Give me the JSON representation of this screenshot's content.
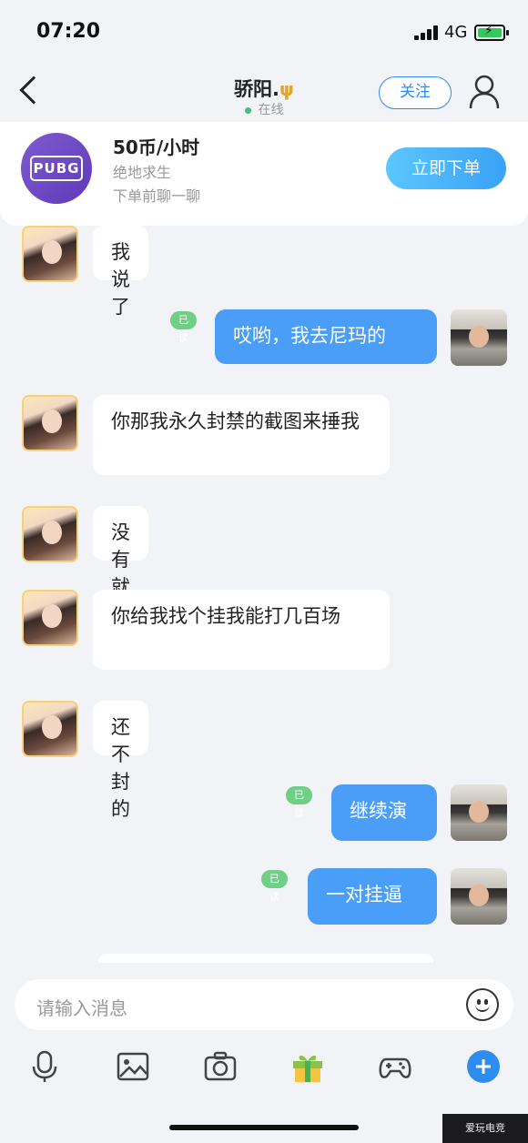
{
  "status": {
    "time": "07:20",
    "network": "4G"
  },
  "header": {
    "title": "骄阳.",
    "title_icon": "trident-icon",
    "online": "在线",
    "follow": "关注"
  },
  "order": {
    "logo_text": "PUBG",
    "price": "50币/小时",
    "game": "绝地求生",
    "hint": "下单前聊一聊",
    "button": "立即下单"
  },
  "messages": [
    {
      "side": "in",
      "text": "我说了"
    },
    {
      "side": "out",
      "text": "哎哟，我去尼玛的",
      "read": "已读"
    },
    {
      "side": "in",
      "text": "你那我永久封禁的截图来捶我"
    },
    {
      "side": "in",
      "text": "没有就别说"
    },
    {
      "side": "in",
      "text": "你给我找个挂我能打几百场"
    },
    {
      "side": "in",
      "text": "还不封的"
    },
    {
      "side": "out",
      "text": "继续演",
      "read": "已读"
    },
    {
      "side": "out",
      "text": "一对挂逼",
      "read": "已读"
    }
  ],
  "composer": {
    "placeholder": "请输入消息"
  },
  "toolbar": [
    "mic-icon",
    "image-icon",
    "camera-icon",
    "gift-icon",
    "gamepad-icon",
    "plus-icon"
  ],
  "watermark": "爱玩电竞"
}
